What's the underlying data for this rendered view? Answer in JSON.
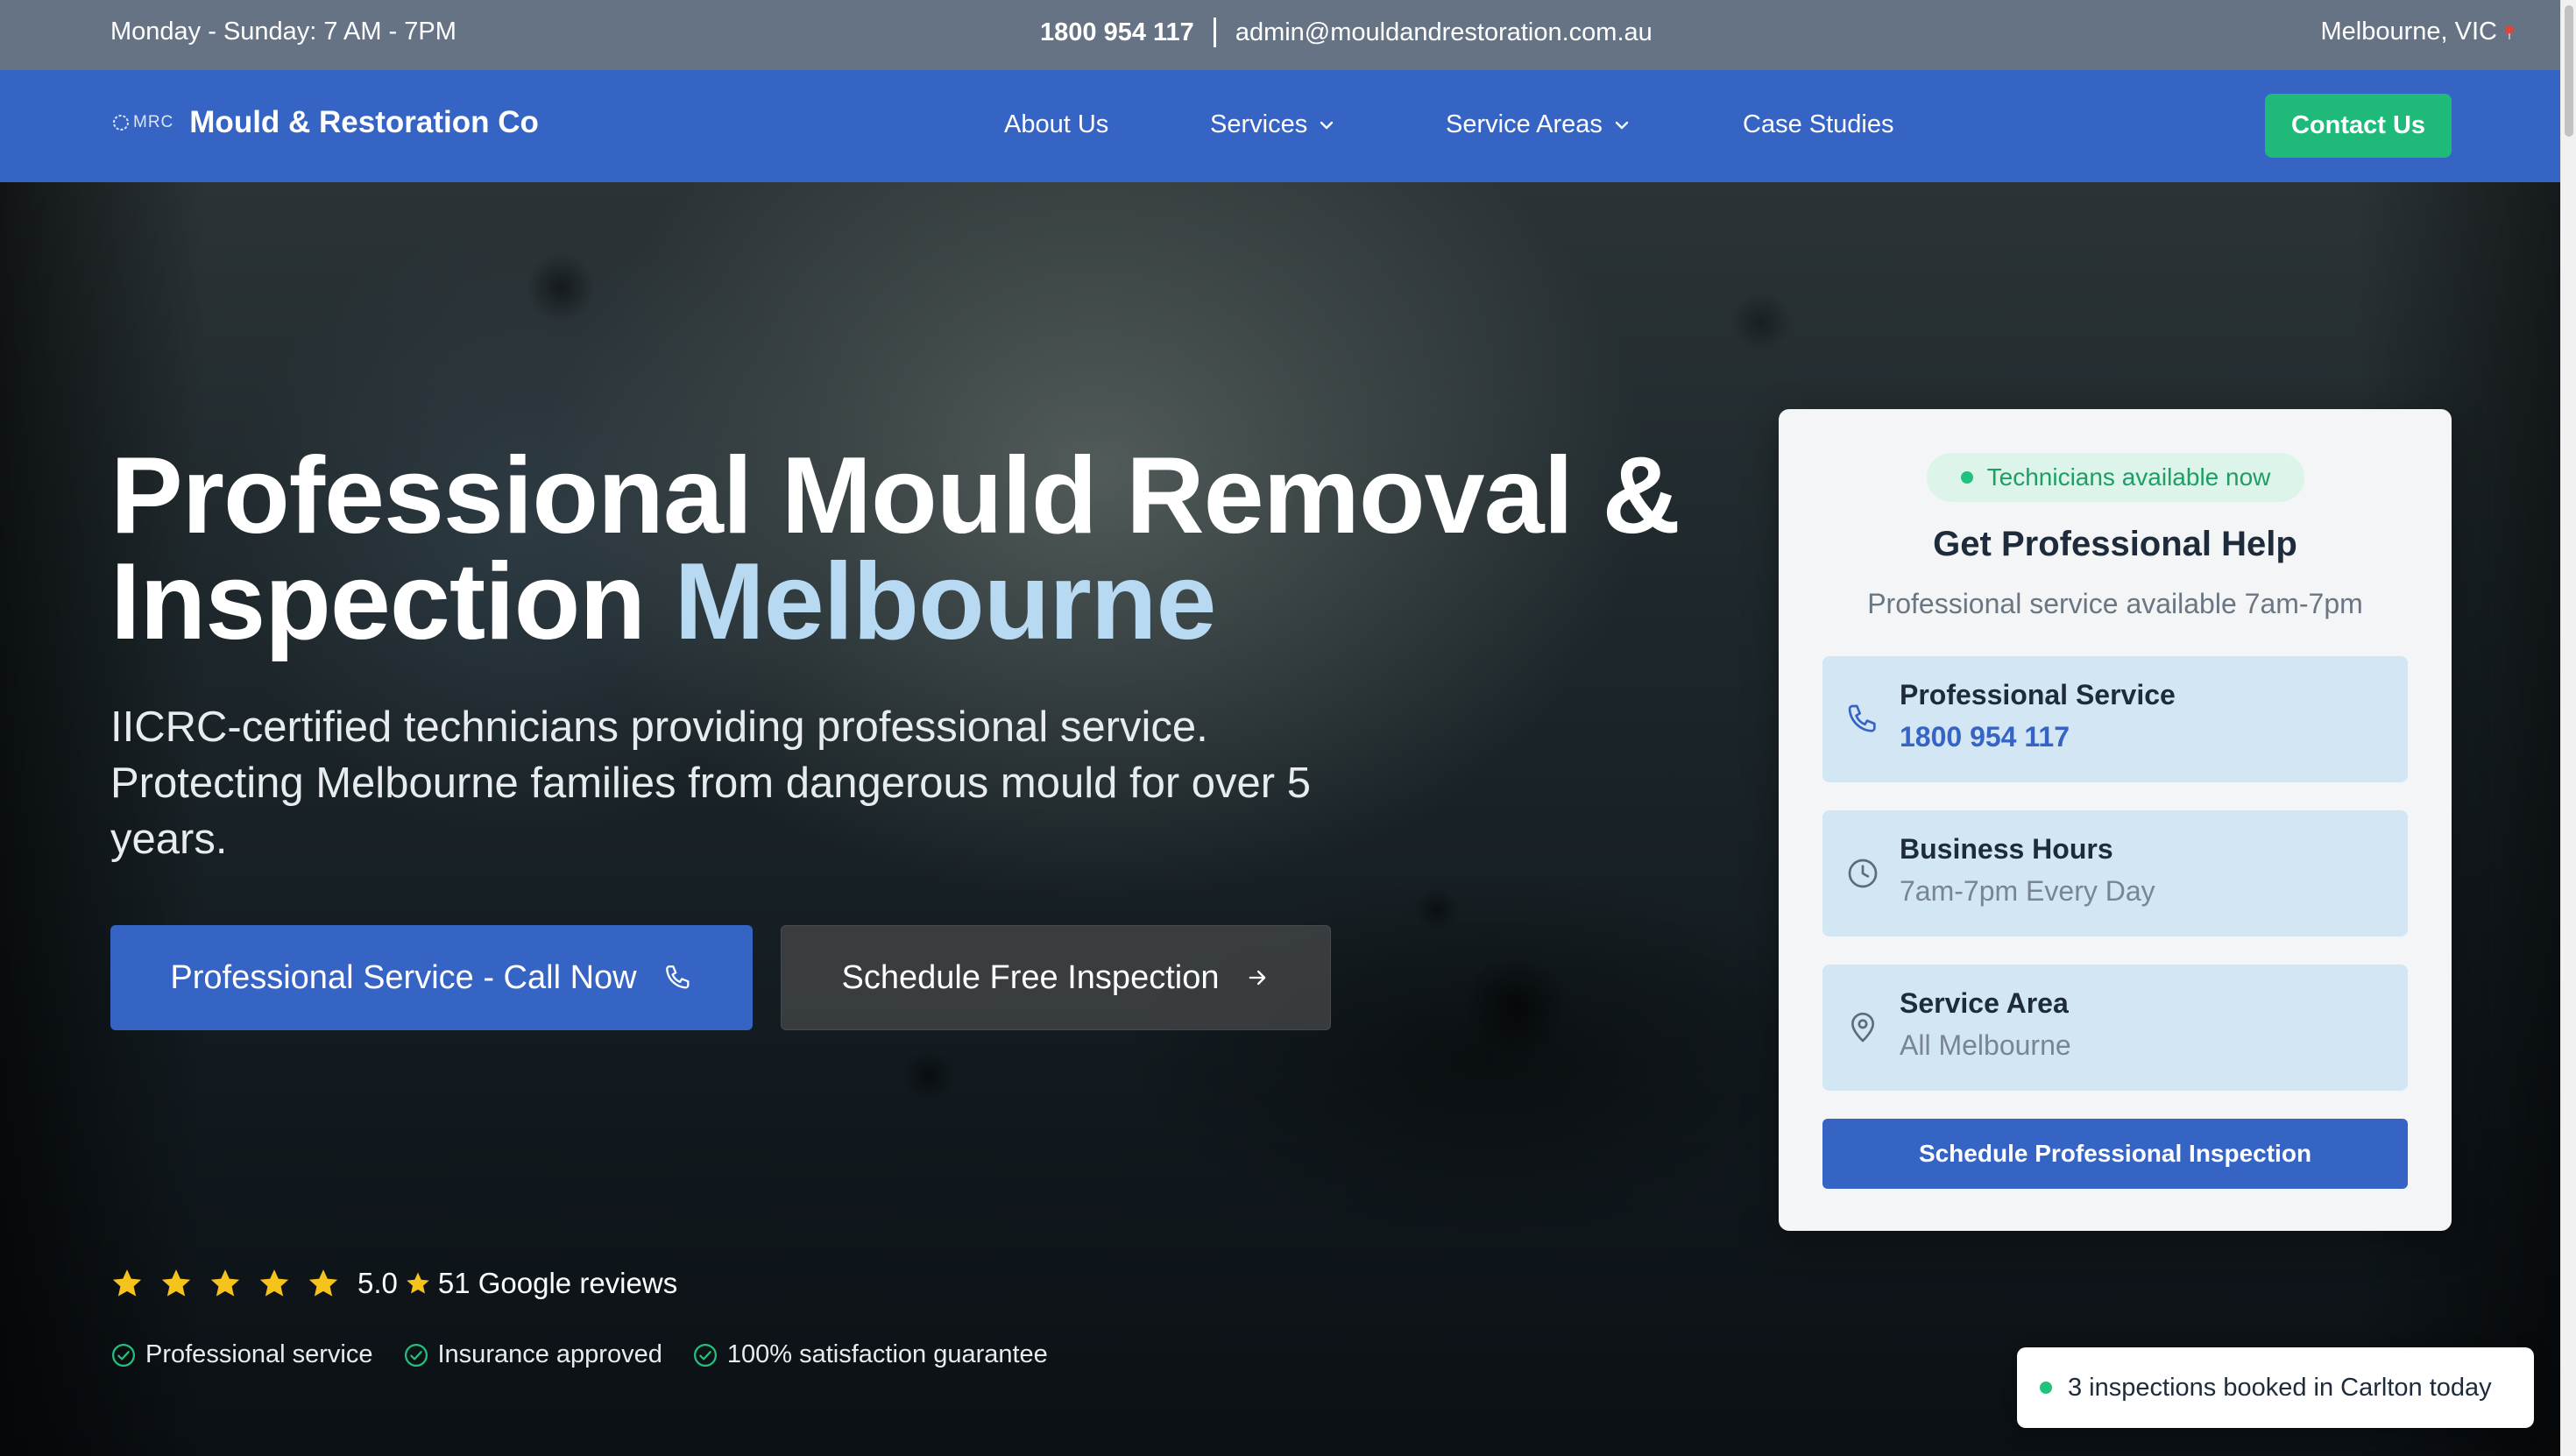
{
  "topbar": {
    "hours": "Monday - Sunday: 7 AM - 7PM",
    "phone": "1800 954 117",
    "email": "admin@mouldandrestoration.com.au",
    "location": "Melbourne, VIC",
    "location_icon": "pin-icon"
  },
  "nav": {
    "logo_text": "MRC",
    "brand": "Mould & Restoration Co",
    "items": [
      {
        "label": "About Us"
      },
      {
        "label": "Services",
        "icon": "chevron-down-icon"
      },
      {
        "label": "Service Areas",
        "icon": "chevron-down-icon"
      },
      {
        "label": "Case Studies"
      }
    ],
    "cta": "Contact Us"
  },
  "hero": {
    "title_main": "Professional Mould Removal & Inspection",
    "title_accent": "Melbourne",
    "subtitle": "IICRC-certified technicians providing professional service. Protecting Melbourne families from dangerous mould for over 5 years.",
    "call_button": "Professional Service - Call Now",
    "schedule_button": "Schedule Free Inspection",
    "rating": {
      "stars": 5,
      "score": "5.0",
      "reviews": "51 Google reviews"
    },
    "assurances": [
      "Professional service",
      "Insurance approved",
      "100% satisfaction guarantee"
    ]
  },
  "card": {
    "badge": "Technicians available now",
    "title": "Get Professional Help",
    "subtitle": "Professional service available 7am-7pm",
    "boxes": [
      {
        "title": "Professional Service",
        "value": "1800 954 117",
        "icon": "phone-icon"
      },
      {
        "title": "Business Hours",
        "value": "7am-7pm Every Day",
        "icon": "clock-icon"
      },
      {
        "title": "Service Area",
        "value": "All Melbourne",
        "icon": "location-pin-icon"
      }
    ],
    "cta": "Schedule Professional Inspection"
  },
  "toast": {
    "text": "3 inspections booked in Carlton today"
  },
  "colors": {
    "primary": "#3564c5",
    "green": "#1fba7a",
    "accent_light": "#b8d9f2",
    "star": "#f6c31c",
    "topbar": "#667385"
  }
}
